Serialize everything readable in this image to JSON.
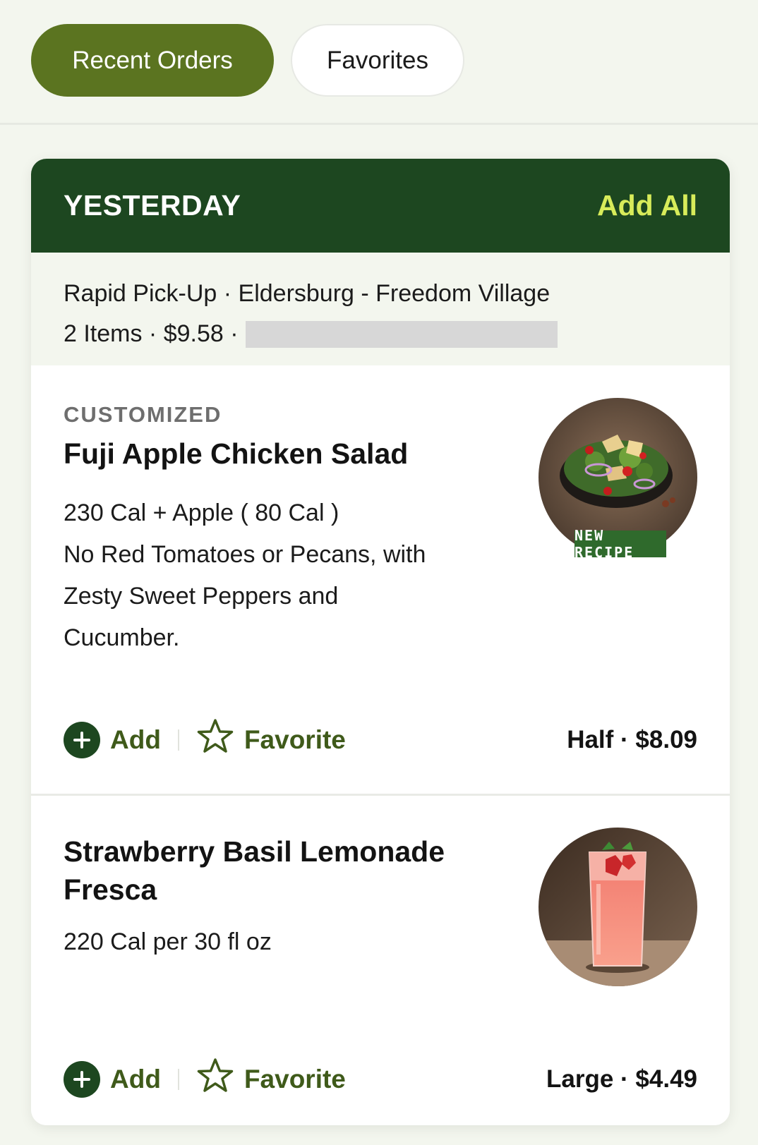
{
  "tabs": {
    "recent_orders": "Recent Orders",
    "favorites": "Favorites"
  },
  "order": {
    "title": "YESTERDAY",
    "add_all": "Add All",
    "pickup_line": "Rapid Pick-Up · Eldersburg - Freedom Village",
    "summary": "2 Items · $9.58 ·"
  },
  "items": [
    {
      "tag": "CUSTOMIZED",
      "name": "Fuji Apple Chicken Salad",
      "desc_line1": "230 Cal + Apple ( 80 Cal )",
      "desc_line2": "No Red Tomatoes or Pecans, with",
      "desc_line3": "Zesty Sweet Peppers and",
      "desc_line4": "Cucumber.",
      "badge": "NEW RECIPE",
      "add_label": "Add",
      "favorite_label": "Favorite",
      "price": "Half · $8.09"
    },
    {
      "name": "Strawberry Basil Lemonade Fresca",
      "desc_line1": "220 Cal per 30 fl oz",
      "add_label": "Add",
      "favorite_label": "Favorite",
      "price": "Large · $4.49"
    }
  ],
  "colors": {
    "brand_green": "#1d4720",
    "active_tab": "#5b7420",
    "accent_lime": "#d8ec5a",
    "action_green": "#3f5a1a"
  }
}
